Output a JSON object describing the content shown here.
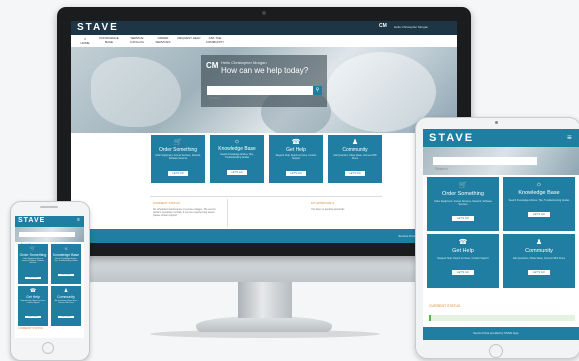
{
  "brand": "STAVE",
  "user": {
    "initials": "CM",
    "name": "Hello Christopher Morgan"
  },
  "nav": [
    "HOME",
    "KNOWLEDGE BASE",
    "SERVICE CATALOG",
    "ORDER SERVICES",
    "REQUEST HELP",
    "ASK THE COMMUNITY"
  ],
  "hero": {
    "hello": "Hello Christopher Morgan",
    "question": "How can we help today?",
    "search_placeholder": "Search"
  },
  "tiles": [
    {
      "title": "Order Something",
      "icon": "cart-icon",
      "desc": "Order Equipment, Access Services, Network, Software Services",
      "button": "LET'S GO"
    },
    {
      "title": "Knowledge Base",
      "icon": "lightbulb-icon",
      "desc": "Search Knowledge Articles, Tips, Troubleshooting Guides",
      "button": "LET'S GO"
    },
    {
      "title": "Get Help",
      "icon": "headset-icon",
      "desc": "Request Help, Report an Issue, Contact Support",
      "button": "LET'S GO"
    },
    {
      "title": "Community",
      "icon": "community-icon",
      "desc": "Ask Questions, Share Ideas, Connect With Peers",
      "button": "LET'S GO"
    }
  ],
  "sections": {
    "current_status": "CURRENT STATUS",
    "status_text": "No scheduled maintenance or service outages. The service portal is operating normally. If you are experiencing issues please contact support.",
    "approvals": "MY APPROVALS",
    "approvals_text": "You have no pending approvals"
  },
  "footer": "Service Portal provided by STAVE Apps",
  "colors": {
    "primary": "#1f7ea1",
    "header_dark": "#1d3544",
    "accent": "#e08a2a"
  }
}
